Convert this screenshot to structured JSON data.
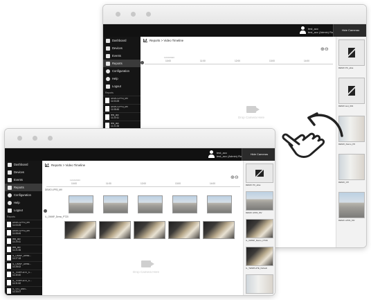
{
  "nav_items": [
    {
      "label": "Dashboard",
      "icon": "dashboard-icon"
    },
    {
      "label": "Devices",
      "icon": "devices-icon"
    },
    {
      "label": "Events",
      "icon": "events-icon"
    },
    {
      "label": "Reports",
      "icon": "reports-icon",
      "active": true
    },
    {
      "label": "Configuration",
      "icon": "gear-icon"
    },
    {
      "label": "Help",
      "icon": "help-icon"
    },
    {
      "label": "Logout",
      "icon": "logout-icon"
    }
  ],
  "reports_section_label": "Reports",
  "back_window": {
    "user_name": "test_acc",
    "user_detail": "test_acc (Admin) Rosen",
    "hide_cameras_label": "Hide Cameras",
    "breadcrumb": "Reports > Video Timeline",
    "zoom_controls": "⊕⊖",
    "ruler_day": "11/10/2023",
    "ruler_ticks": [
      "10:00",
      "11:00",
      "12:00",
      "13:00",
      "14:00"
    ],
    "drop_hint": "Drop Camera Here",
    "report_items": [
      {
        "line1": "DEMO-LPR3_MV",
        "line2": "11:03:25"
      },
      {
        "line1": "DEMO-LPR3_MV",
        "line2": "11:08:45"
      },
      {
        "line1": "test_acc",
        "line2": "11:20:11"
      },
      {
        "line1": "test_acc",
        "line2": "11:21:35"
      },
      {
        "line1": "IL_OMNP_Demo...",
        "line2": "11:27:18"
      }
    ],
    "cameras": [
      {
        "label": "DEMO PC_afsa"
      },
      {
        "label": "DEMO test_001"
      },
      {
        "label": "DEMO_Demo_P0"
      },
      {
        "label": "DEMO_Off"
      },
      {
        "label": "DEMO LPR3_MV"
      }
    ]
  },
  "front_window": {
    "user_name": "test_acc",
    "user_detail": "test_acc (Admin) Rosen",
    "hide_cameras_label": "Hide Cameras",
    "breadcrumb": "Reports > Video Timeline",
    "zoom_controls": "⊕⊖",
    "ruler_day": "11/10/2023",
    "ruler_ticks": [
      "10:00",
      "11:00",
      "12:00",
      "13:00",
      "14:00"
    ],
    "track_1_label": "DEMO LPR3_MV",
    "track_2_label": "IL_OMNP_Demo_PTZ0",
    "drop_hint": "Drop Camera Here",
    "report_items": [
      {
        "line1": "DEMO-LPR3_MV",
        "line2": "11:03:25"
      },
      {
        "line1": "DEMO-LPR3_MV",
        "line2": "11:08:45"
      },
      {
        "line1": "test_acc",
        "line2": "11:20:11"
      },
      {
        "line1": "test_acc",
        "line2": "11:21:35"
      },
      {
        "line1": "IL_OMNP_Demo...",
        "line2": "11:27:18"
      },
      {
        "line1": "IL_OMNP_Demo...",
        "line2": "11:28:02"
      },
      {
        "line1": "IL_TEMPLATE_S...",
        "line2": "11:30:40"
      },
      {
        "line1": "IL_TEMPLATE_S...",
        "line2": "11:31:52"
      },
      {
        "line1": "IL_V31_ANN...",
        "line2": "11:33:07"
      }
    ],
    "cameras": [
      {
        "label": "DEMO PC_afsa"
      },
      {
        "label": "DEMO LPR3_MV"
      },
      {
        "label": "IL_OMNP_Demo_PTZ0"
      },
      {
        "label": "IL_TEMPLATE_Default"
      },
      {
        "label": ""
      }
    ]
  },
  "colors": {
    "topbar": "#111111",
    "sidebar": "#151515",
    "page": "#ffffff"
  }
}
